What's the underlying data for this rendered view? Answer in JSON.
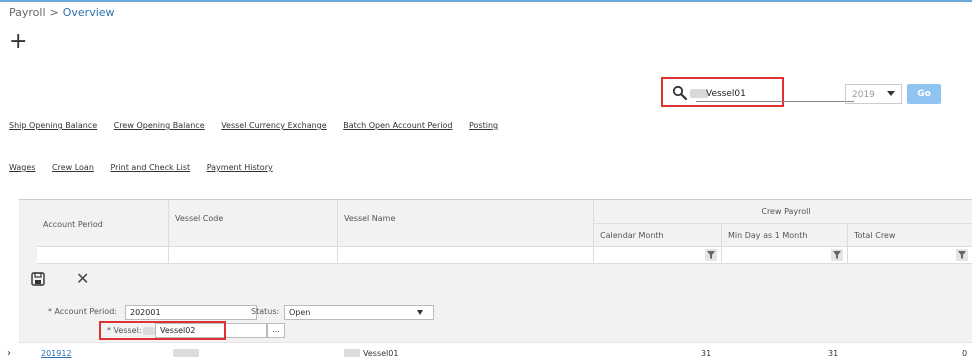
{
  "breadcrumb": {
    "parent": "Payroll",
    "separator": ">",
    "current": "Overview"
  },
  "toolbar": {
    "add_icon": "plus-icon",
    "add_label": "+"
  },
  "search": {
    "value": "Vessel01",
    "year": "2019",
    "go_label": "Go",
    "icon": "search-icon"
  },
  "links_row1": [
    "Ship Opening Balance",
    "Crew Opening Balance",
    "Vessel Currency Exchange",
    "Batch Open Account Period",
    "Posting"
  ],
  "links_row2": [
    "Wages",
    "Crew Loan",
    "Print and Check List",
    "Payment History"
  ],
  "grid": {
    "columns": [
      "Account Period",
      "Vessel Code",
      "Vessel Name"
    ],
    "group_header": "Crew Payroll",
    "sub_columns": [
      "Calendar Month",
      "Min Day as 1 Month",
      "Total Crew"
    ]
  },
  "edit_form": {
    "account_period_label": "* Account Period:",
    "account_period_value": "202001",
    "status_label": "Status:",
    "status_value": "Open",
    "vessel_label": "* Vessel:",
    "vessel_value": "Vessel02",
    "browse_label": "..."
  },
  "row": {
    "account_period": "201912",
    "vessel_name": "Vessel01",
    "calendar_month": "31",
    "min_day": "31",
    "total_crew": "0"
  },
  "colors": {
    "accent": "#2a6fb0",
    "highlight": "#dd3333",
    "go_button": "#8fc3f0"
  }
}
